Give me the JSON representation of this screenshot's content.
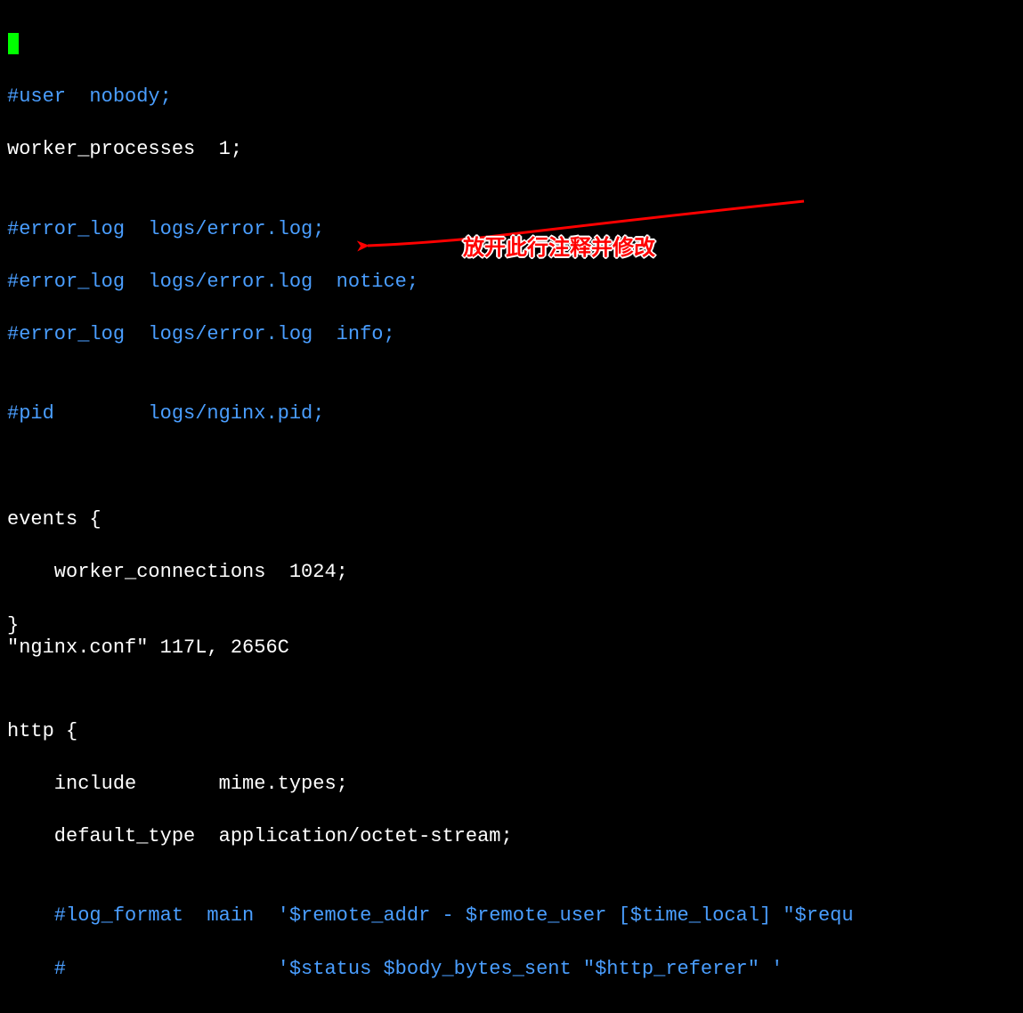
{
  "lines": {
    "l0_cursor": "█",
    "l1": "#user  nobody;",
    "l2_a": "worker_processes",
    "l2_b": "  1;",
    "l3": "",
    "l4": "#error_log  logs/error.log;",
    "l5": "#error_log  logs/error.log  notice;",
    "l6": "#error_log  logs/error.log  info;",
    "l7": "",
    "l8": "#pid        logs/nginx.pid;",
    "l9": "",
    "l10": "",
    "l11_a": "events",
    "l11_b": " {",
    "l12": "    worker_connections  1024;",
    "l13": "}",
    "l14": "",
    "l15": "",
    "l16_a": "http",
    "l16_b": " {",
    "l17": "    include       mime.types;",
    "l18": "    default_type  application/octet-stream;",
    "l19": "",
    "l20": "    #log_format  main  '$remote_addr - $remote_user [$time_local] \"$requ",
    "l21": "    #                  '$status $body_bytes_sent \"$http_referer\" '"
  },
  "status": "\"nginx.conf\" 117L, 2656C",
  "annotation": "放开此行注释并修改"
}
